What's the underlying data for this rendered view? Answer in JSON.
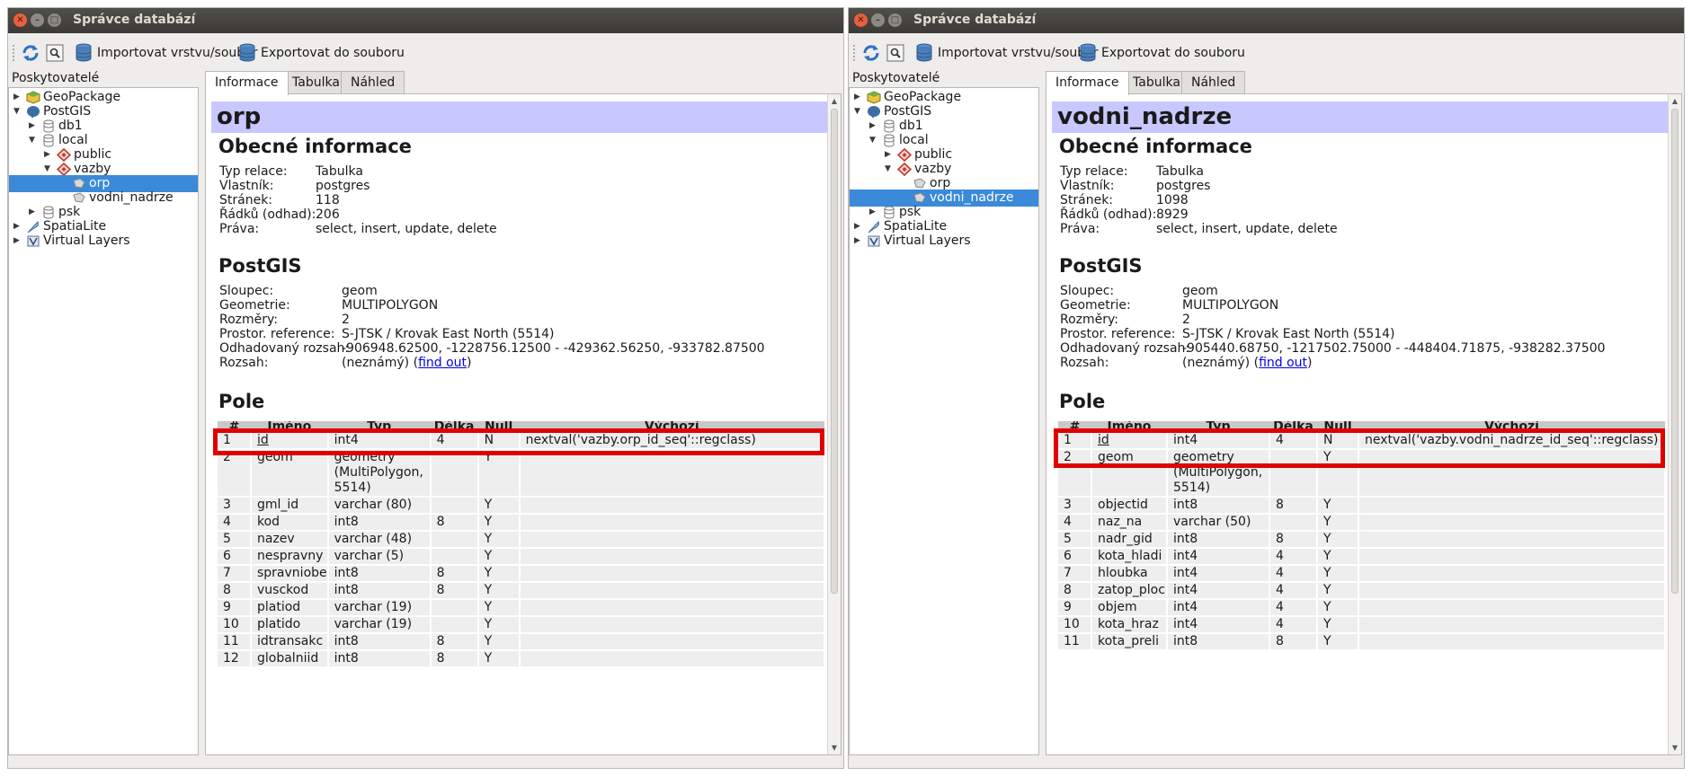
{
  "windows": [
    {
      "title": "Správce databází",
      "toolbar": {
        "import_label": "Importovat vrstvu/soubor",
        "export_label": "Exportovat do souboru"
      },
      "providers_label": "Poskytovatelé",
      "tree": [
        {
          "label": "GeoPackage"
        },
        {
          "label": "PostGIS"
        },
        {
          "label": "db1"
        },
        {
          "label": "local"
        },
        {
          "label": "public"
        },
        {
          "label": "vazby"
        },
        {
          "label": "orp"
        },
        {
          "label": "vodni_nadrze"
        },
        {
          "label": "psk"
        },
        {
          "label": "SpatiaLite"
        },
        {
          "label": "Virtual Layers"
        }
      ],
      "selected_item": "orp",
      "tabs": [
        "Informace",
        "Tabulka",
        "Náhled"
      ],
      "object_name": "orp",
      "general": {
        "heading": "Obecné informace",
        "rows": [
          {
            "k": "Typ relace:",
            "v": "Tabulka"
          },
          {
            "k": "Vlastník:",
            "v": "postgres"
          },
          {
            "k": "Stránek:",
            "v": "118"
          },
          {
            "k": "Řádků (odhad):",
            "v": "206"
          },
          {
            "k": "Práva:",
            "v": "select, insert, update, delete"
          }
        ]
      },
      "postgis": {
        "heading": "PostGIS",
        "rows": [
          {
            "k": "Sloupec:",
            "v": "geom"
          },
          {
            "k": "Geometrie:",
            "v": "MULTIPOLYGON"
          },
          {
            "k": "Rozměry:",
            "v": "2"
          },
          {
            "k": "Prostor. reference:",
            "v": "S-JTSK / Krovak East North (5514)"
          },
          {
            "k": "Odhadovaný rozsah:",
            "v": "-906948.62500, -1228756.12500 - -429362.56250, -933782.87500"
          },
          {
            "k": "Rozsah:",
            "v": "(neznámý)",
            "link": "find out"
          }
        ]
      },
      "fields": {
        "heading": "Pole",
        "columns": [
          "#",
          "Jméno",
          "Typ",
          "Délka",
          "Null",
          "Výchozí"
        ],
        "rows": [
          [
            "1",
            "id",
            "int4",
            "4",
            "N",
            "nextval('vazby.orp_id_seq'::regclass)"
          ],
          [
            "2",
            "geom",
            "geometry (MultiPolygon, 5514)",
            "",
            "Y",
            ""
          ],
          [
            "3",
            "gml_id",
            "varchar (80)",
            "",
            "Y",
            ""
          ],
          [
            "4",
            "kod",
            "int8",
            "8",
            "Y",
            ""
          ],
          [
            "5",
            "nazev",
            "varchar (48)",
            "",
            "Y",
            ""
          ],
          [
            "6",
            "nespravny",
            "varchar (5)",
            "",
            "Y",
            ""
          ],
          [
            "7",
            "spravniobe",
            "int8",
            "8",
            "Y",
            ""
          ],
          [
            "8",
            "vusckod",
            "int8",
            "8",
            "Y",
            ""
          ],
          [
            "9",
            "platiod",
            "varchar (19)",
            "",
            "Y",
            ""
          ],
          [
            "10",
            "platido",
            "varchar (19)",
            "",
            "Y",
            ""
          ],
          [
            "11",
            "idtransakc",
            "int8",
            "8",
            "Y",
            ""
          ],
          [
            "12",
            "globalniid",
            "int8",
            "8",
            "Y",
            ""
          ]
        ]
      }
    },
    {
      "title": "Správce databází",
      "toolbar": {
        "import_label": "Importovat vrstvu/soubor",
        "export_label": "Exportovat do souboru"
      },
      "providers_label": "Poskytovatelé",
      "tree": [
        {
          "label": "GeoPackage"
        },
        {
          "label": "PostGIS"
        },
        {
          "label": "db1"
        },
        {
          "label": "local"
        },
        {
          "label": "public"
        },
        {
          "label": "vazby"
        },
        {
          "label": "orp"
        },
        {
          "label": "vodni_nadrze"
        },
        {
          "label": "psk"
        },
        {
          "label": "SpatiaLite"
        },
        {
          "label": "Virtual Layers"
        }
      ],
      "selected_item": "vodni_nadrze",
      "tabs": [
        "Informace",
        "Tabulka",
        "Náhled"
      ],
      "object_name": "vodni_nadrze",
      "general": {
        "heading": "Obecné informace",
        "rows": [
          {
            "k": "Typ relace:",
            "v": "Tabulka"
          },
          {
            "k": "Vlastník:",
            "v": "postgres"
          },
          {
            "k": "Stránek:",
            "v": "1098"
          },
          {
            "k": "Řádků (odhad):",
            "v": "8929"
          },
          {
            "k": "Práva:",
            "v": "select, insert, update, delete"
          }
        ]
      },
      "postgis": {
        "heading": "PostGIS",
        "rows": [
          {
            "k": "Sloupec:",
            "v": "geom"
          },
          {
            "k": "Geometrie:",
            "v": "MULTIPOLYGON"
          },
          {
            "k": "Rozměry:",
            "v": "2"
          },
          {
            "k": "Prostor. reference:",
            "v": "S-JTSK / Krovak East North (5514)"
          },
          {
            "k": "Odhadovaný rozsah:",
            "v": "-905440.68750, -1217502.75000 - -448404.71875, -938282.37500"
          },
          {
            "k": "Rozsah:",
            "v": "(neznámý)",
            "link": "find out"
          }
        ]
      },
      "fields": {
        "heading": "Pole",
        "columns": [
          "#",
          "Jméno",
          "Typ",
          "Délka",
          "Null",
          "Výchozí"
        ],
        "rows": [
          [
            "1",
            "id",
            "int4",
            "4",
            "N",
            "nextval('vazby.vodni_nadrze_id_seq'::regclass)"
          ],
          [
            "2",
            "geom",
            "geometry (MultiPolygon, 5514)",
            "",
            "Y",
            ""
          ],
          [
            "3",
            "objectid",
            "int8",
            "8",
            "Y",
            ""
          ],
          [
            "4",
            "naz_na",
            "varchar (50)",
            "",
            "Y",
            ""
          ],
          [
            "5",
            "nadr_gid",
            "int8",
            "8",
            "Y",
            ""
          ],
          [
            "6",
            "kota_hladi",
            "int4",
            "4",
            "Y",
            ""
          ],
          [
            "7",
            "hloubka",
            "int4",
            "4",
            "Y",
            ""
          ],
          [
            "8",
            "zatop_ploc",
            "int4",
            "4",
            "Y",
            ""
          ],
          [
            "9",
            "objem",
            "int4",
            "4",
            "Y",
            ""
          ],
          [
            "10",
            "kota_hraz",
            "int4",
            "4",
            "Y",
            ""
          ],
          [
            "11",
            "kota_preli",
            "int8",
            "8",
            "Y",
            ""
          ]
        ]
      }
    }
  ],
  "colors": {
    "titlebar": "#3b3a36",
    "selection": "#3b8ad9",
    "object_title_bg": "#c8c8ff",
    "highlight": "#e00000",
    "link": "#0000ee"
  }
}
